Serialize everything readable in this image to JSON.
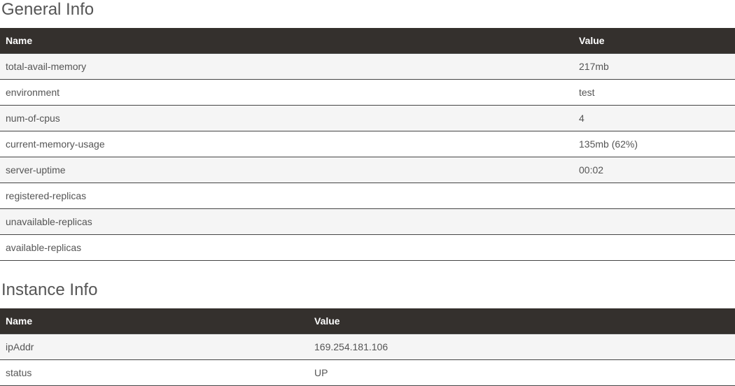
{
  "sections": {
    "general": {
      "title": "General Info",
      "headers": {
        "name": "Name",
        "value": "Value"
      },
      "rows": [
        {
          "name": "total-avail-memory",
          "value": "217mb"
        },
        {
          "name": "environment",
          "value": "test"
        },
        {
          "name": "num-of-cpus",
          "value": "4"
        },
        {
          "name": "current-memory-usage",
          "value": "135mb (62%)"
        },
        {
          "name": "server-uptime",
          "value": "00:02"
        },
        {
          "name": "registered-replicas",
          "value": ""
        },
        {
          "name": "unavailable-replicas",
          "value": ""
        },
        {
          "name": "available-replicas",
          "value": ""
        }
      ]
    },
    "instance": {
      "title": "Instance Info",
      "headers": {
        "name": "Name",
        "value": "Value"
      },
      "rows": [
        {
          "name": "ipAddr",
          "value": "169.254.181.106"
        },
        {
          "name": "status",
          "value": "UP"
        }
      ]
    }
  }
}
